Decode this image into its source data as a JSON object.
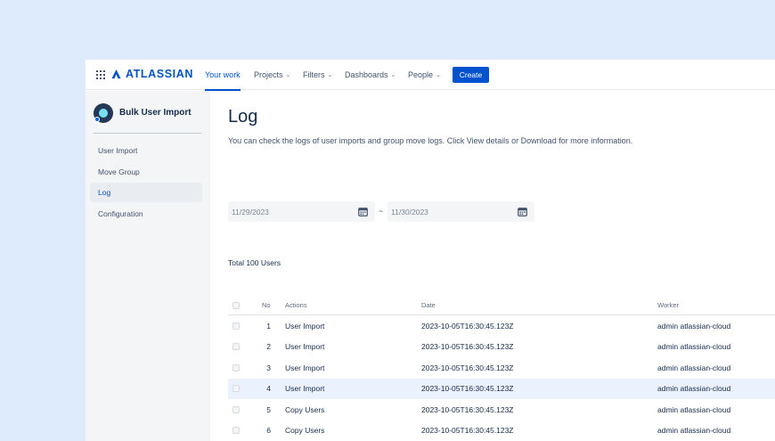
{
  "nav": {
    "logo_text": "ATLASSIAN",
    "items": [
      {
        "label": "Your work",
        "has_chevron": false,
        "active": true
      },
      {
        "label": "Projects",
        "has_chevron": true,
        "active": false
      },
      {
        "label": "Filters",
        "has_chevron": true,
        "active": false
      },
      {
        "label": "Dashboards",
        "has_chevron": true,
        "active": false
      },
      {
        "label": "People",
        "has_chevron": true,
        "active": false
      }
    ],
    "create_label": "Create"
  },
  "sidebar": {
    "app_name": "Bulk User Import",
    "items": [
      {
        "label": "User Import",
        "active": false
      },
      {
        "label": "Move Group",
        "active": false
      },
      {
        "label": "Log",
        "active": true
      },
      {
        "label": "Configuration",
        "active": false
      }
    ]
  },
  "main": {
    "title": "Log",
    "description": "You can check the logs of user imports and group move logs. Click View details or Download for more information.",
    "date_from": "11/29/2023",
    "date_separator": "~",
    "date_to": "11/30/2023",
    "total": "Total 100 Users"
  },
  "table": {
    "headers": {
      "no": "No",
      "actions": "Actions",
      "date": "Date",
      "worker": "Worker"
    },
    "rows": [
      {
        "no": "1",
        "action": "User Import",
        "date": "2023-10-05T16:30:45.123Z",
        "worker": "admin atlassian-cloud",
        "highlight": false
      },
      {
        "no": "2",
        "action": "User Import",
        "date": "2023-10-05T16:30:45.123Z",
        "worker": "admin atlassian-cloud",
        "highlight": false
      },
      {
        "no": "3",
        "action": "User Import",
        "date": "2023-10-05T16:30:45.123Z",
        "worker": "admin atlassian-cloud",
        "highlight": false
      },
      {
        "no": "4",
        "action": "User Import",
        "date": "2023-10-05T16:30:45.123Z",
        "worker": "admin atlassian-cloud",
        "highlight": true
      },
      {
        "no": "5",
        "action": "Copy Users",
        "date": "2023-10-05T16:30:45.123Z",
        "worker": "admin atlassian-cloud",
        "highlight": false
      },
      {
        "no": "6",
        "action": "Copy Users",
        "date": "2023-10-05T16:30:45.123Z",
        "worker": "admin atlassian-cloud",
        "highlight": false
      }
    ]
  },
  "colors": {
    "brand": "#0052cc",
    "background": "#deebfd",
    "sidebar": "#f4f5f7",
    "row_highlight": "#ebf2fd"
  }
}
